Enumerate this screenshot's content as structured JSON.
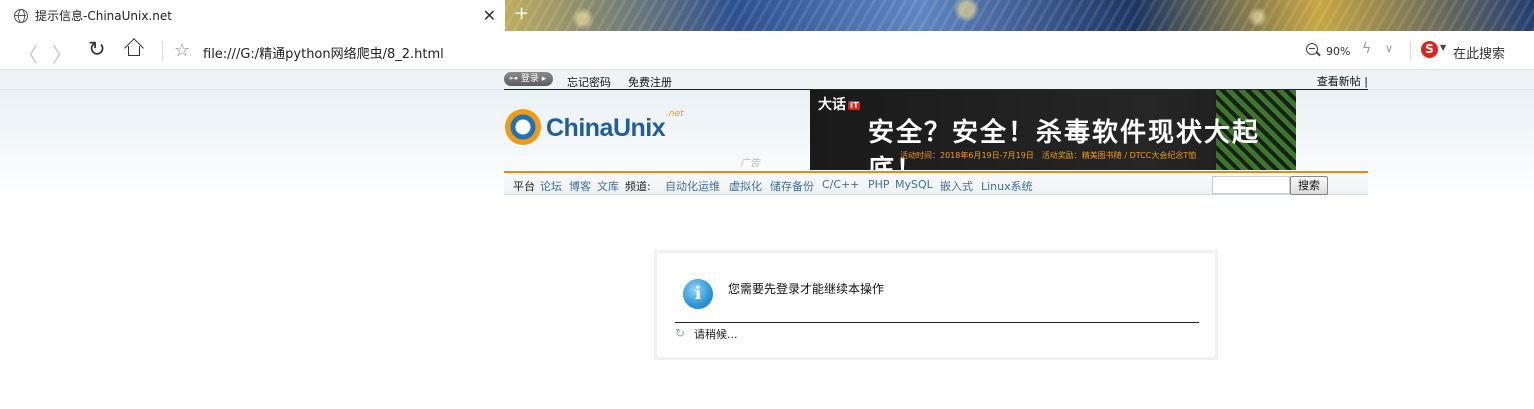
{
  "browser": {
    "tab_title": "提示信息-ChinaUnix.net",
    "url": "file:///G:/精通python网络爬虫/8_2.html",
    "zoom": "90%",
    "search_label": "在此搜索",
    "icons": [
      "globe-icon",
      "close-icon",
      "new-tab-icon",
      "back-icon",
      "forward-icon",
      "reload-icon",
      "home-icon",
      "star-icon",
      "zoom-icon",
      "bolt-icon",
      "chevron-down-icon",
      "sogou-icon"
    ]
  },
  "site": {
    "topbar": {
      "login_label": "登录",
      "forgot_password": "忘记密码",
      "register": "免费注册",
      "new_posts": "查看新帖 |"
    },
    "logo": {
      "text": "ChinaUnix",
      "suffix": ".net"
    },
    "ad_label": "广告",
    "banner": {
      "brand": "大话",
      "brand_badge": "IT",
      "headline": "安全？安全！杀毒软件现状大起底！",
      "sub": "活动时间：2018年6月19日-7月19日　活动奖励：精美图书随 / DTCC大会纪念T恤"
    },
    "navbar": {
      "platform_label": "平台",
      "platform_links": [
        "论坛",
        "博客",
        "文库"
      ],
      "channel_label": "频道:",
      "channel_links": [
        "自动化运维",
        "虚拟化",
        "储存备份",
        "C/C++",
        "PHP",
        "MySQL",
        "嵌入式",
        "Linux系统"
      ],
      "search_button": "搜索"
    },
    "message": {
      "text": "您需要先登录才能继续本操作",
      "wait": "请稍候..."
    }
  }
}
